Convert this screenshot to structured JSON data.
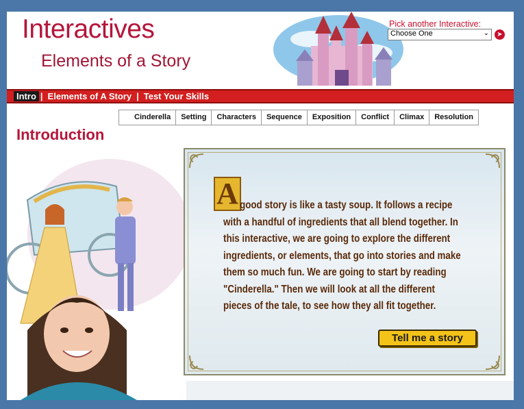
{
  "header": {
    "logo_text": "Interactives",
    "subtitle": "Elements of a Story",
    "pick_label": "Pick another Interactive:",
    "select_value": "Choose One",
    "go_icon": "arrow-right-circle-icon"
  },
  "nav": {
    "tabs": [
      {
        "label": "Intro",
        "active": true
      },
      {
        "label": "Elements of A Story",
        "active": false
      },
      {
        "label": "Test Your Skills",
        "active": false
      }
    ],
    "separator": "|"
  },
  "subtabs": [
    "Cinderella",
    "Setting",
    "Characters",
    "Sequence",
    "Exposition",
    "Conflict",
    "Climax",
    "Resolution"
  ],
  "page": {
    "title": "Introduction"
  },
  "story": {
    "dropcap": "A",
    "text": "good story is like a tasty soup.  It follows a recipe with a handful of ingredients that all blend together.  In this interactive, we are going to explore the different ingredients, or elements, that go into stories and make them so much fun.  We are going to start by reading \"Cinderella.\"  Then we will look at all the different pieces of the tale, to see how they all fit together.",
    "button_label": "Tell me a story"
  },
  "colors": {
    "brand_red": "#b4163a",
    "nav_red": "#d31f1f",
    "button_yellow": "#f3c31a",
    "story_brown": "#5a2a0a",
    "page_bg": "#4a76a8"
  }
}
